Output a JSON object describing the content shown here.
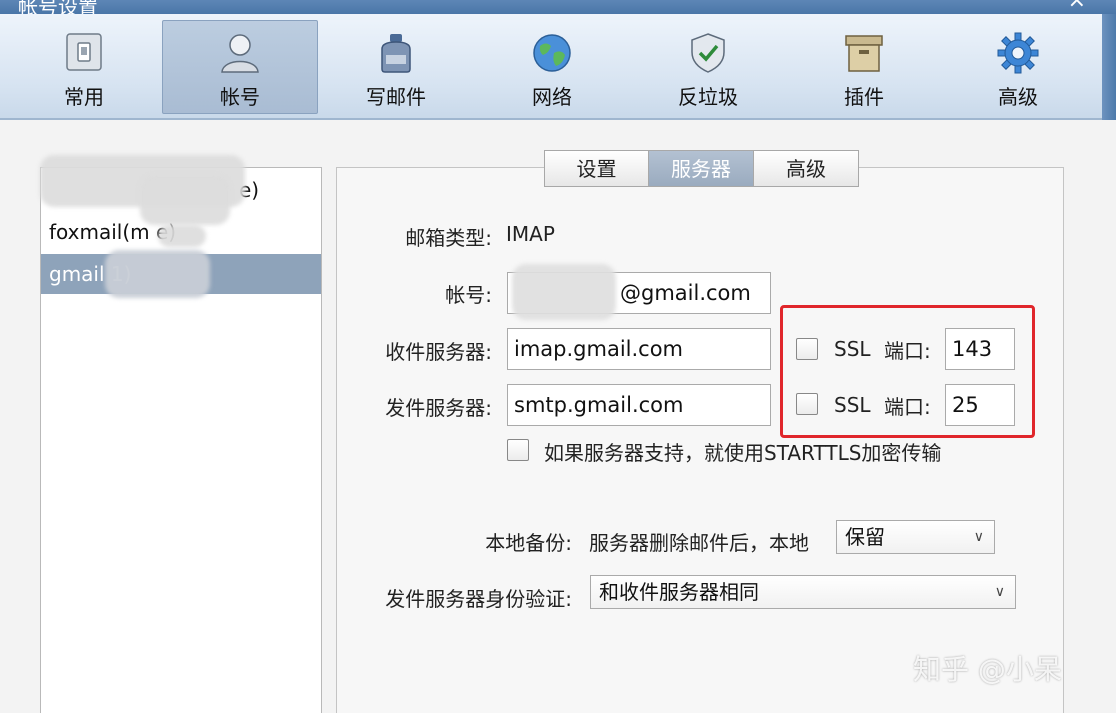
{
  "window": {
    "title": "帐号设置",
    "close_glyph": "×"
  },
  "toolbar": {
    "items": [
      {
        "label": "常用",
        "icon": "phone-icon"
      },
      {
        "label": "帐号",
        "icon": "user-icon",
        "active": true
      },
      {
        "label": "写邮件",
        "icon": "ink-bottle-icon"
      },
      {
        "label": "网络",
        "icon": "globe-icon"
      },
      {
        "label": "反垃圾",
        "icon": "shield-check-icon"
      },
      {
        "label": "插件",
        "icon": "box-icon"
      },
      {
        "label": "高级",
        "icon": "gear-icon"
      }
    ]
  },
  "accounts": [
    {
      "label": "e)"
    },
    {
      "label": "foxmail(m      e)"
    },
    {
      "label": "gmail           1)",
      "selected": true
    }
  ],
  "subtabs": [
    "设置",
    "服务器",
    "高级"
  ],
  "server": {
    "mailbox_type_label": "邮箱类型:",
    "mailbox_type_value": "IMAP",
    "account_label": "帐号:",
    "account_value": "@gmail.com",
    "incoming_label": "收件服务器:",
    "incoming_value": "imap.gmail.com",
    "incoming_ssl": "SSL",
    "incoming_port_label": "端口:",
    "incoming_port": "143",
    "outgoing_label": "发件服务器:",
    "outgoing_value": "smtp.gmail.com",
    "outgoing_ssl": "SSL",
    "outgoing_port_label": "端口:",
    "outgoing_port": "25",
    "starttls_label": "如果服务器支持，就使用STARTTLS加密传输",
    "backup_label": "本地备份:",
    "backup_desc": "服务器删除邮件后，本地",
    "backup_option": "保留",
    "auth_label": "发件服务器身份验证:",
    "auth_option": "和收件服务器相同"
  },
  "watermark": "知乎 @小呆",
  "colors": {
    "highlight": "#e0262b",
    "selected_row": "#8ea3ba"
  }
}
